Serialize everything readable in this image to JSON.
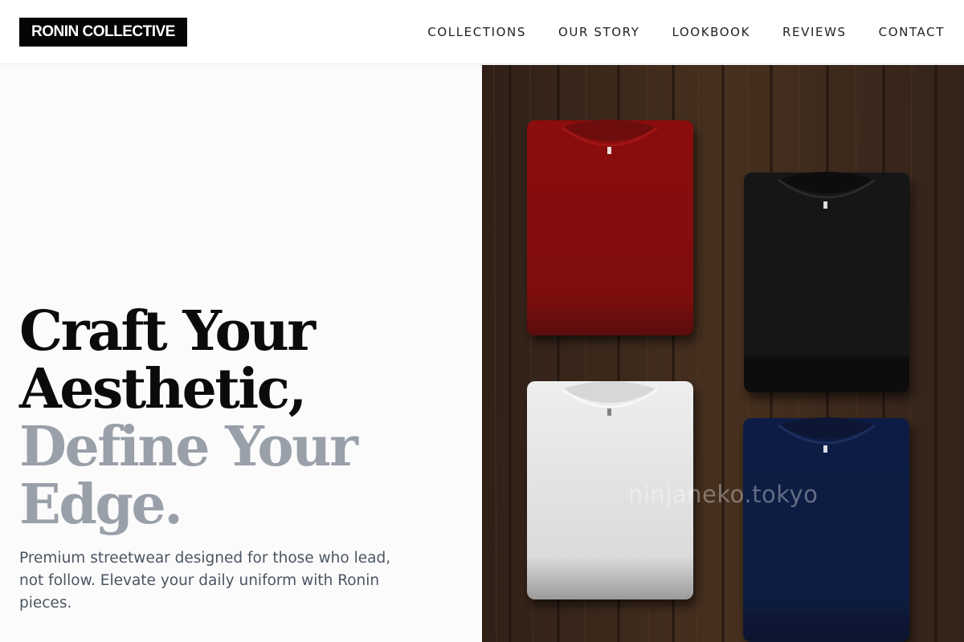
{
  "brand": {
    "name": "RONIN COLLECTIVE"
  },
  "nav": {
    "items": [
      "COLLECTIONS",
      "OUR STORY",
      "LOOKBOOK",
      "REVIEWS",
      "CONTACT"
    ]
  },
  "hero": {
    "headline_dark": [
      "Craft Your",
      "Aesthetic,"
    ],
    "headline_gray": [
      "Define Your",
      "Edge."
    ],
    "subtext": "Premium streetwear designed for those who lead, not follow. Elevate your daily uniform with Ronin pieces.",
    "image_watermark": "ninjaneko.tokyo",
    "shirt_colors": [
      "#8b0d0d",
      "#141414",
      "#eeeeee",
      "#0f1f45"
    ],
    "wood_color": "#3e2a1e"
  },
  "colors": {
    "headline_dark": "#0b0b0b",
    "headline_gray": "#9aa0aa",
    "body_text": "#4b5563",
    "logo_bg": "#050505"
  }
}
